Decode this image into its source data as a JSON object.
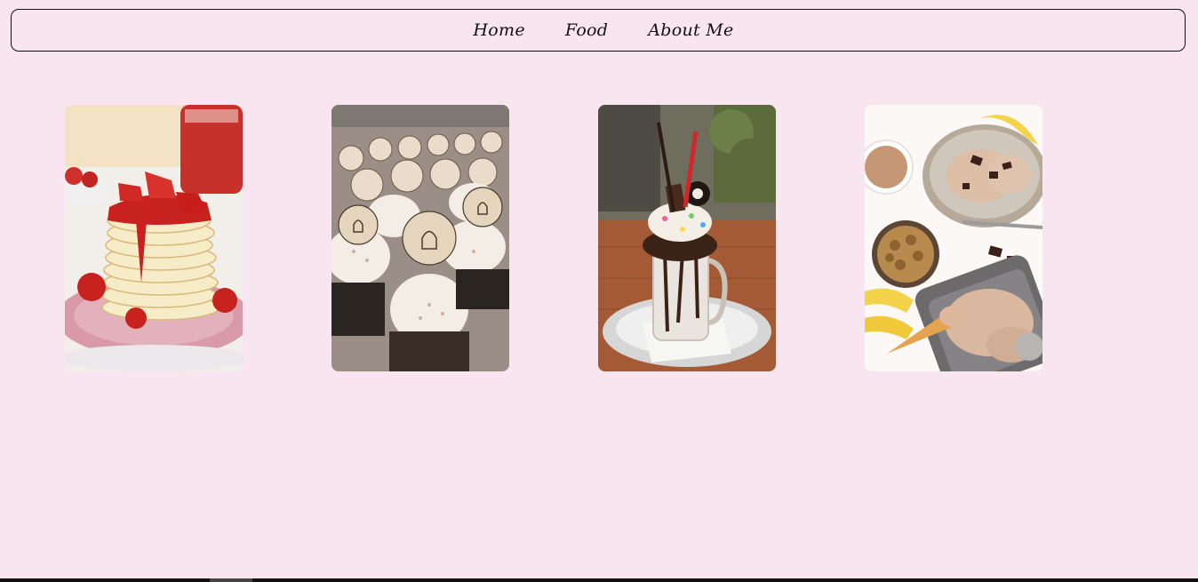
{
  "nav": {
    "items": [
      {
        "label": "Home"
      },
      {
        "label": "Food"
      },
      {
        "label": "About Me"
      }
    ]
  },
  "gallery": {
    "items": [
      {
        "icon": "pancake-stack-image",
        "subject": "strawberry pancakes"
      },
      {
        "icon": "cupcakes-image",
        "subject": "guinness cupcakes"
      },
      {
        "icon": "freakshake-image",
        "subject": "chocolate milkshake"
      },
      {
        "icon": "ice-cream-image",
        "subject": "banana nut ice cream"
      }
    ]
  },
  "colors": {
    "background": "#f9e5f0",
    "nav_border": "#111111",
    "text": "#111111"
  }
}
